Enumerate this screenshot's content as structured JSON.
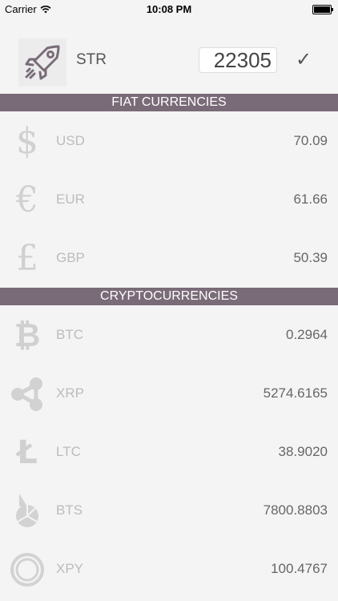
{
  "status_bar": {
    "carrier": "Carrier",
    "time": "10:08 PM"
  },
  "header": {
    "coin": "STR",
    "amount": "22305",
    "confirm_symbol": "✓"
  },
  "sections": {
    "fiat": "FIAT CURRENCIES",
    "crypto": "CRYPTOCURRENCIES"
  },
  "fiat": [
    {
      "code": "USD",
      "value": "70.09",
      "icon": "dollar-icon",
      "glyph": "$"
    },
    {
      "code": "EUR",
      "value": "61.66",
      "icon": "euro-icon",
      "glyph": "€"
    },
    {
      "code": "GBP",
      "value": "50.39",
      "icon": "pound-icon",
      "glyph": "£"
    }
  ],
  "crypto": [
    {
      "code": "BTC",
      "value": "0.2964",
      "icon": "bitcoin-icon",
      "glyph": "₿"
    },
    {
      "code": "XRP",
      "value": "5274.6165",
      "icon": "ripple-icon"
    },
    {
      "code": "LTC",
      "value": "38.9020",
      "icon": "litecoin-icon",
      "glyph": "Ł"
    },
    {
      "code": "BTS",
      "value": "7800.8803",
      "icon": "bitshares-icon"
    },
    {
      "code": "XPY",
      "value": "100.4767",
      "icon": "paycoin-icon"
    }
  ]
}
